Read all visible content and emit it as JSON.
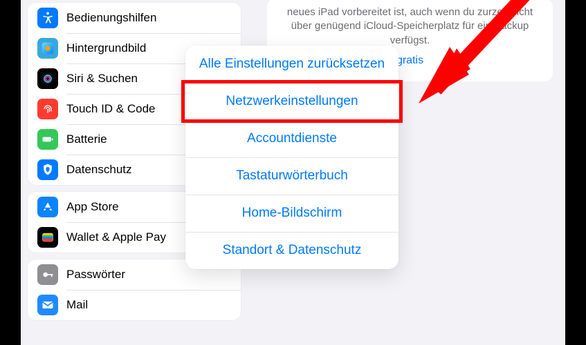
{
  "sidebar": {
    "group1": [
      {
        "label": "Bedienungshilfen",
        "icon": "accessibility",
        "bg": "#007aff"
      },
      {
        "label": "Hintergrundbild",
        "icon": "wallpaper",
        "bg": "#34aadc"
      },
      {
        "label": "Siri & Suchen",
        "icon": "siri",
        "bg": "#000000"
      },
      {
        "label": "Touch ID & Code",
        "icon": "fingerprint",
        "bg": "#ff3b30"
      },
      {
        "label": "Batterie",
        "icon": "battery",
        "bg": "#34c759"
      },
      {
        "label": "Datenschutz",
        "icon": "privacy",
        "bg": "#007aff"
      }
    ],
    "group2": [
      {
        "label": "App Store",
        "icon": "appstore",
        "bg": "#0a84ff"
      },
      {
        "label": "Wallet & Apple Pay",
        "icon": "wallet",
        "bg": "#000000"
      }
    ],
    "group3": [
      {
        "label": "Passwörter",
        "icon": "key",
        "bg": "#8e8e93"
      },
      {
        "label": "Mail",
        "icon": "mail",
        "bg": "#1f8bff"
      }
    ]
  },
  "detail": {
    "info_text": "neues iPad vorbereitet ist, auch wenn du zurzeit nicht über genügend iCloud-Speicherplatz für ein Backup verfügst.",
    "info_link": "gratis"
  },
  "sheet": {
    "items": [
      "Alle Einstellungen zurücksetzen",
      "Netzwerkeinstellungen",
      "Accountdienste",
      "Tastaturwörterbuch",
      "Home-Bildschirm",
      "Standort & Datenschutz"
    ]
  },
  "annotation": {
    "highlight_index": 1
  }
}
